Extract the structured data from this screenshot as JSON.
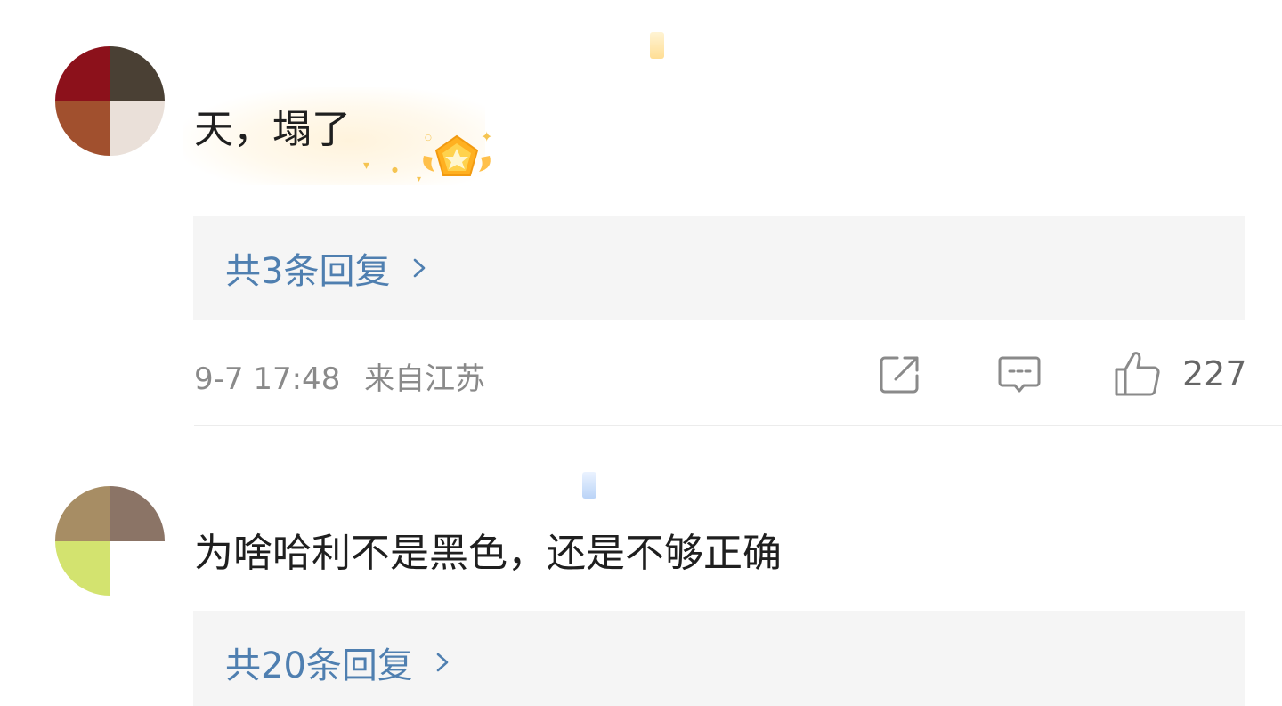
{
  "comments": [
    {
      "username": "",
      "text": "天，塌了",
      "replies_label": "共3条回复",
      "timestamp": "9-7 17:48",
      "location": "来自江苏",
      "like_count": "227",
      "avatar_colors": [
        "#8c111b",
        "#4a4034",
        "#a1502e",
        "#eae0d9"
      ]
    },
    {
      "username": "",
      "text": "为啥哈利不是黑色，还是不够正确",
      "replies_label": "共20条回复",
      "avatar_colors": [
        "#a78d64",
        "#8b7466",
        "#d3e36f",
        "#ffffff"
      ]
    }
  ],
  "colors": {
    "link": "#4f7fb0",
    "meta_text": "#8a8a8a",
    "reply_bg": "#f5f5f5"
  }
}
